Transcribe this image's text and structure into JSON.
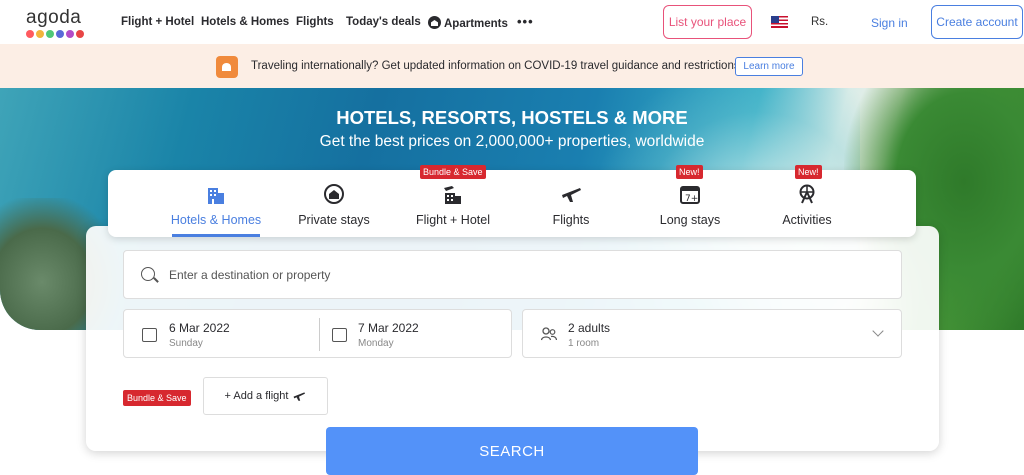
{
  "nav": {
    "logo_text": "agoda",
    "logo_dot_colors": [
      "#ff5a5f",
      "#f2b43c",
      "#50c878",
      "#5a6ad8",
      "#b34cc8",
      "#e84545"
    ],
    "links": [
      "Flight + Hotel",
      "Hotels & Homes",
      "Flights",
      "Today's deals",
      "Apartments"
    ],
    "more": "•••",
    "list_place": "List your place",
    "currency": "Rs.",
    "sign_in": "Sign in",
    "create_account": "Create account"
  },
  "banner": {
    "text": "Traveling internationally? Get updated information on COVID-19 travel guidance and restrictions.",
    "button": "Learn more"
  },
  "hero": {
    "title": "HOTELS, RESORTS, HOSTELS & MORE",
    "subtitle": "Get the best prices on 2,000,000+ properties, worldwide"
  },
  "tabs": [
    {
      "label": "Hotels & Homes",
      "icon": "hotel-icon",
      "active": true
    },
    {
      "label": "Private stays",
      "icon": "home-icon"
    },
    {
      "label": "Flight + Hotel",
      "icon": "flight-hotel-icon",
      "tag": "Bundle & Save"
    },
    {
      "label": "Flights",
      "icon": "plane-icon"
    },
    {
      "label": "Long stays",
      "icon": "calendar-icon",
      "tag": "New!"
    },
    {
      "label": "Activities",
      "icon": "ferris-wheel-icon",
      "tag": "New!"
    }
  ],
  "search": {
    "placeholder": "Enter a destination or property",
    "checkin": {
      "date": "6 Mar 2022",
      "day": "Sunday"
    },
    "checkout": {
      "date": "7 Mar 2022",
      "day": "Monday"
    },
    "guests": {
      "main": "2 adults",
      "sub": "1 room"
    },
    "bundle_tag": "Bundle & Save",
    "add_flight": "+ Add a flight",
    "search_button": "SEARCH"
  }
}
